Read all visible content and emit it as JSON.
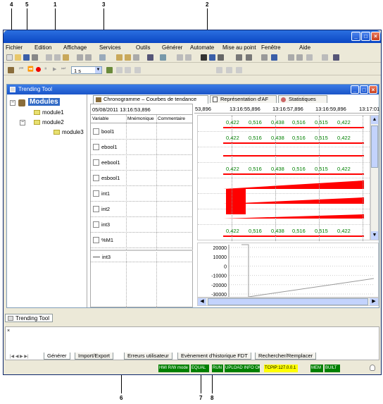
{
  "callouts": [
    "4",
    "5",
    "1",
    "3",
    "2",
    "6",
    "7",
    "8"
  ],
  "menu": [
    "Fichier",
    "Edition",
    "Affichage",
    "Services",
    "Outils",
    "Générer",
    "Automate",
    "Mise au point",
    "Fenêtre",
    "Aide"
  ],
  "toolbar2": {
    "step_value": "1 s"
  },
  "inner_title": "Trending Tool",
  "tree": {
    "root": "Modules",
    "items": [
      "module1",
      "module2",
      "module3"
    ]
  },
  "tabs": [
    "Chronogramme – Courbes de tendance",
    "Représentation d'AF",
    "Statistiques"
  ],
  "time_header": {
    "current": "05/08/2011 13:16:53,896",
    "ticks": [
      "53,896",
      "13:16:55,896",
      "13:16:57,896",
      "13:16:59,896",
      "13:17:01"
    ]
  },
  "table_headers": [
    "Variable",
    "Mnémonique",
    "Commentaire"
  ],
  "variables": [
    "bool1",
    "ebool1",
    "eebool1",
    "esbool1",
    "int1",
    "int2",
    "int3",
    "%M1"
  ],
  "lower_variable": "int3",
  "row_values": [
    [
      "0,422",
      "0,516",
      "0,438",
      "0,516",
      "0,515",
      "0,422"
    ],
    [
      "0,422",
      "0,516",
      "0,438",
      "0,516",
      "0,515",
      "0,422"
    ],
    [],
    [
      "0,422",
      "0,516",
      "0,438",
      "0,516",
      "0,515",
      "0,422"
    ],
    [],
    [],
    [],
    [
      "0,422",
      "0,516",
      "0,438",
      "0,516",
      "0,515",
      "0,422"
    ]
  ],
  "y_axis_ticks": [
    "20000",
    "10000",
    "0",
    "-10000",
    "-20000",
    "-30000"
  ],
  "bottom_panel_tab": "Trending Tool",
  "output_tabs": [
    "Générer",
    "Import/Export",
    "Erreurs utilisateur",
    "Evènement d'historique FDT",
    "Rechercher/Remplacer"
  ],
  "status": [
    "HMI R/W mode",
    "EQUAL",
    "RUN",
    "UPLOAD INFO OK",
    "TCPIP:127.0.0.1",
    "MEM",
    "BUILT"
  ],
  "colors": {
    "accent": "#0b47c4",
    "value_green": "#008000",
    "signal_red": "#ff0000"
  }
}
